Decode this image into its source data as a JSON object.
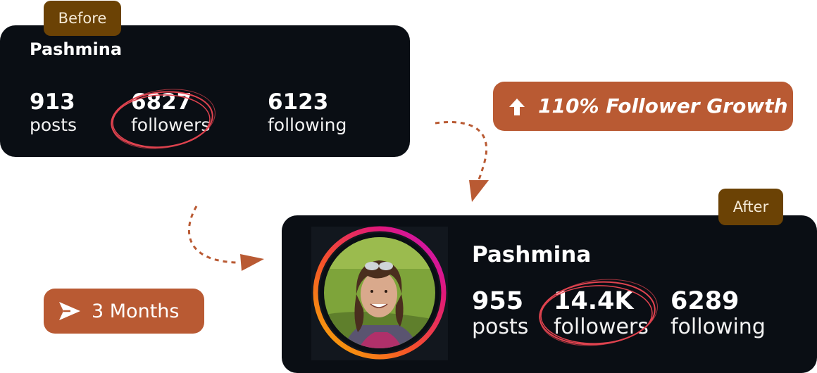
{
  "before": {
    "tag": "Before",
    "name": "Pashmina",
    "posts": {
      "value": "913",
      "label": "posts"
    },
    "followers": {
      "value": "6827",
      "label": "followers"
    },
    "following": {
      "value": "6123",
      "label": "following"
    }
  },
  "after": {
    "tag": "After",
    "name": "Pashmina",
    "posts": {
      "value": "955",
      "label": "posts"
    },
    "followers": {
      "value": "14.4K",
      "label": "followers"
    },
    "following": {
      "value": "6289",
      "label": "following"
    }
  },
  "growth": {
    "label": "110% Follower Growth",
    "icon": "arrow-up-icon"
  },
  "duration": {
    "label": "3 Months",
    "icon": "send-icon"
  },
  "colors": {
    "card": "#0a0e14",
    "tag": "#6b4205",
    "accent": "#b95a33",
    "circle": "#e0434f"
  }
}
